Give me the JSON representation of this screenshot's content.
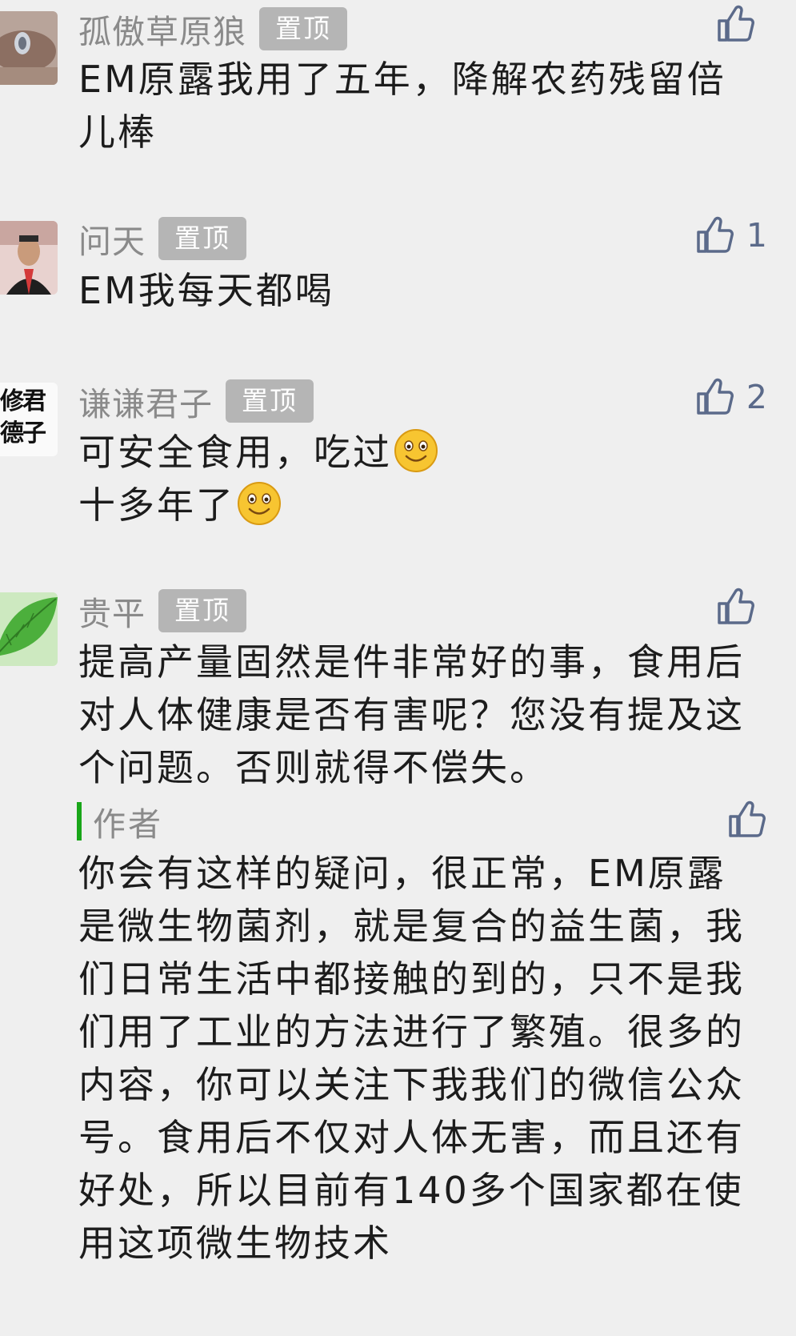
{
  "comments": [
    {
      "name": "孤傲草原狼",
      "pin": "置顶",
      "like_count": "",
      "lines": [
        "EM原露我用了五年，降解农药残留倍",
        "儿棒"
      ]
    },
    {
      "name": "问天",
      "pin": "置顶",
      "like_count": "1",
      "lines": [
        "EM我每天都喝"
      ]
    },
    {
      "name": "谦谦君子",
      "pin": "置顶",
      "like_count": "2",
      "lines": [
        "可安全食用，吃过",
        "十多年了"
      ],
      "avatar_text": [
        "修君",
        "德子"
      ]
    },
    {
      "name": "贵平",
      "pin": "置顶",
      "like_count": "",
      "lines": [
        "提高产量固然是件非常好的事，食用后",
        "对人体健康是否有害呢？您没有提及这",
        "个问题。否则就得不偿失。"
      ]
    }
  ],
  "author_reply": {
    "label": "作者",
    "lines": [
      "你会有这样的疑问，很正常，EM原露",
      "是微生物菌剂，就是复合的益生菌，我",
      "们日常生活中都接触的到的，只不是我",
      "们用了工业的方法进行了繁殖。很多的",
      "内容，你可以关注下我我们的微信公众",
      "号。食用后不仅对人体无害，而且还有",
      "好处，所以目前有140多个国家都在使",
      "用这项微生物技术"
    ]
  },
  "colors": {
    "background": "#efefef",
    "name_text": "#8a8a8a",
    "pin_badge": "#b5b5b5",
    "like_icon": "#5b6a8a",
    "author_bar": "#19a619"
  },
  "icons": [
    "thumbs-up-icon",
    "smiley-emoji"
  ]
}
